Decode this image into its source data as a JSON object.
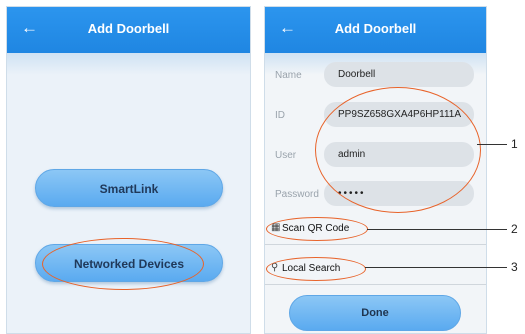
{
  "left_screen": {
    "header": {
      "back_icon": "arrow-left-icon",
      "title": "Add Doorbell"
    },
    "smartlink_label": "SmartLink",
    "networked_devices_label": "Networked Devices"
  },
  "right_screen": {
    "header": {
      "back_icon": "arrow-left-icon",
      "title": "Add Doorbell"
    },
    "fields": {
      "name": {
        "label": "Name",
        "value": "Doorbell"
      },
      "id": {
        "label": "ID",
        "value": "PP9SZ658GXA4P6HP111A"
      },
      "user": {
        "label": "User",
        "value": "admin"
      },
      "password": {
        "label": "Password",
        "value": "•••••"
      }
    },
    "scan_qr": {
      "icon": "qr-code-icon",
      "label": "Scan QR Code"
    },
    "local_search": {
      "icon": "search-icon",
      "label": "Local Search"
    },
    "done_label": "Done"
  },
  "callouts": [
    "1",
    "2",
    "3"
  ],
  "colors": {
    "header_blue": "#2290ea",
    "button_blue": "#6fb6f2",
    "highlight_orange": "#e8632a"
  }
}
